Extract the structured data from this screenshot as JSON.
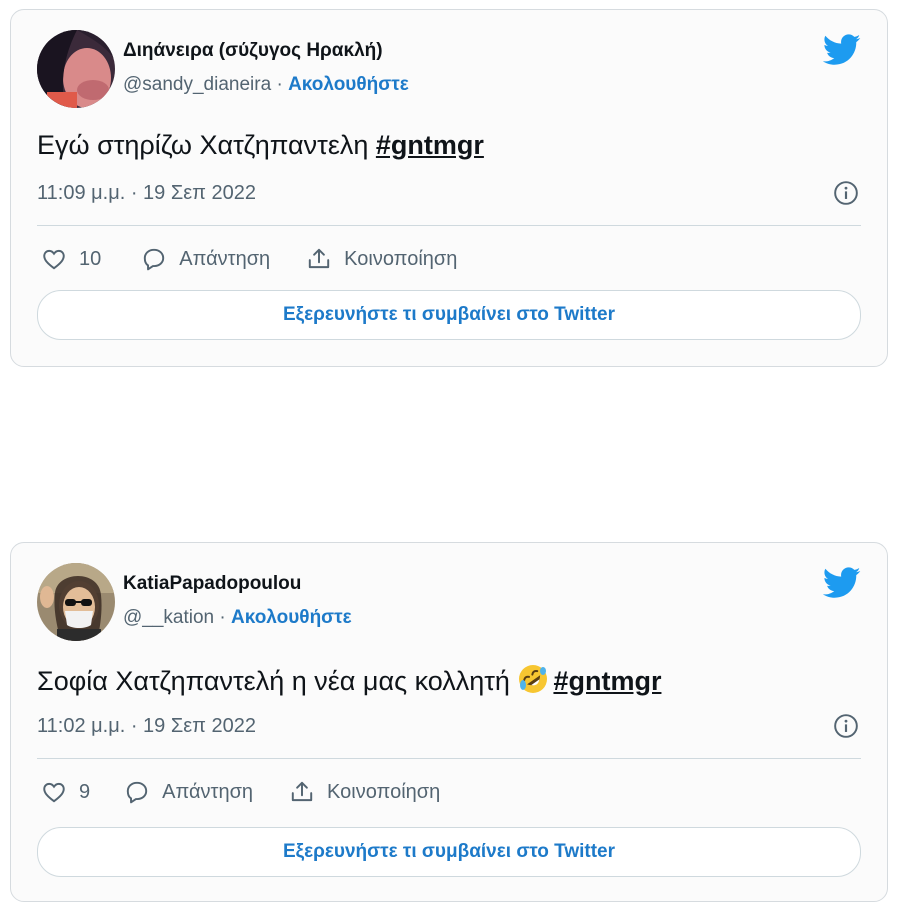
{
  "tweets": [
    {
      "display_name": "Διηάνειρα (σύζυγος Ηρακλή)",
      "handle": "@sandy_dianeira",
      "separator": " · ",
      "follow_label": "Ακολουθήστε",
      "text": "Εγώ στηρίζω Χατζηπαντελη ",
      "hashtag": "#gntmgr",
      "timestamp": "11:09 μ.μ. · 19 Σεπ 2022",
      "likes": "10",
      "reply_label": "Απάντηση",
      "share_label": "Κοινοποίηση",
      "explore_label": "Εξερευνήστε τι συμβαίνει στο Twitter"
    },
    {
      "display_name": "KatiaPapadopoulou",
      "handle": "@__kation",
      "separator": " · ",
      "follow_label": "Ακολουθήστε",
      "text": "Σοφία Χατζηπαντελή η νέα μας κολλητή ",
      "emoji": "rolling-on-floor-laughing-emoji",
      "hashtag": "#gntmgr",
      "timestamp": "11:02 μ.μ. · 19 Σεπ 2022",
      "likes": "9",
      "reply_label": "Απάντηση",
      "share_label": "Κοινοποίηση",
      "explore_label": "Εξερευνήστε τι συμβαίνει στο Twitter"
    }
  ],
  "colors": {
    "twitter_blue": "#1d9bf0",
    "link_blue": "#1d7ac9",
    "text_dark": "#0f1419",
    "text_muted": "#536471",
    "border": "#d6dbdf"
  },
  "icons": [
    "twitter-bird-icon",
    "info-icon",
    "heart-icon",
    "reply-bubble-icon",
    "share-icon"
  ]
}
